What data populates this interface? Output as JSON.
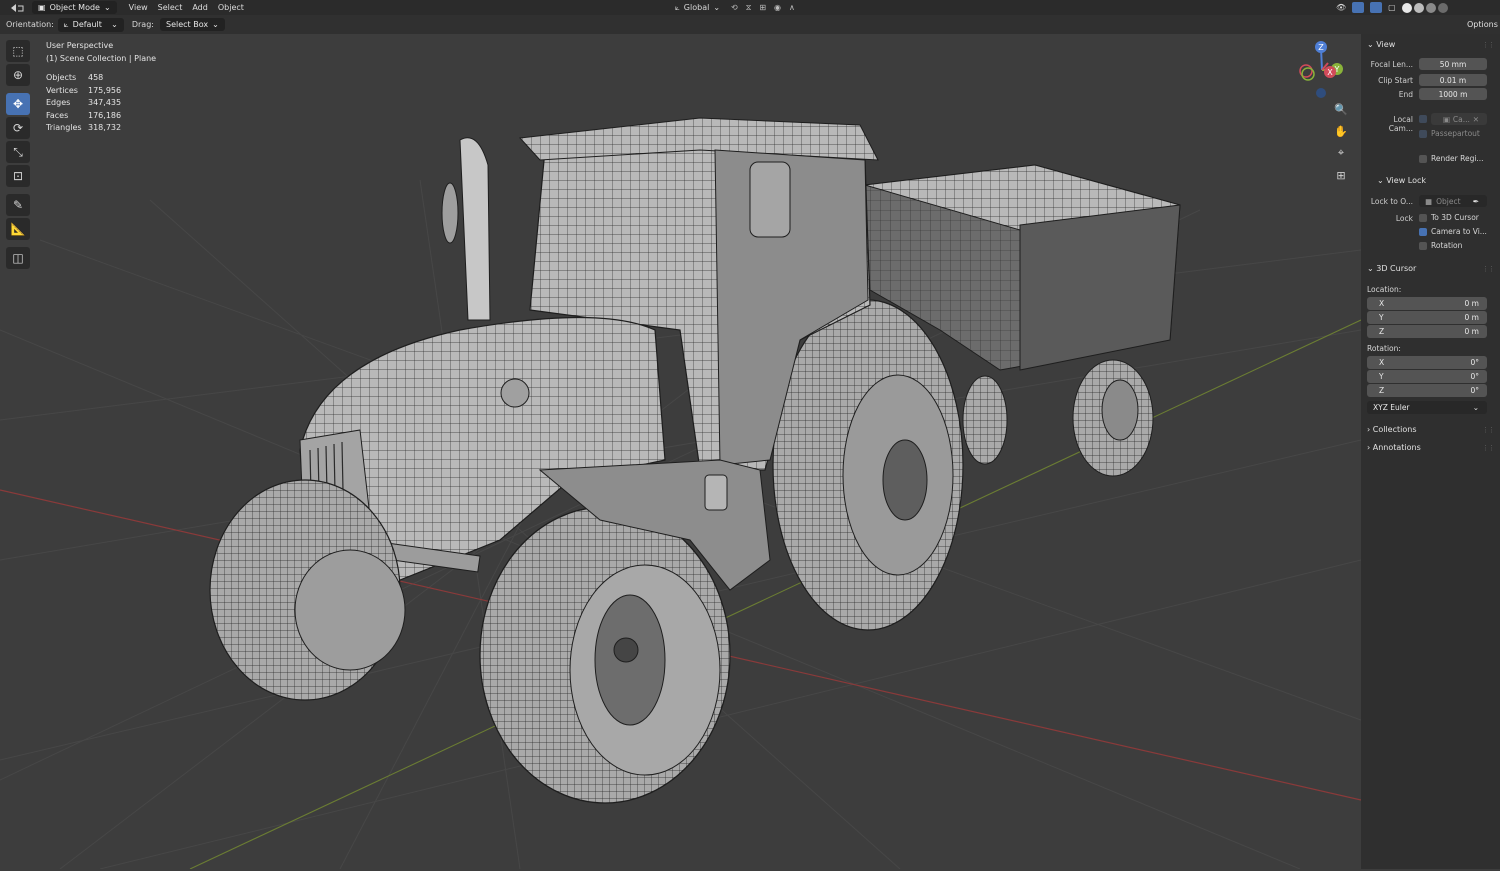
{
  "header": {
    "mode": "Object Mode",
    "menus": [
      "View",
      "Select",
      "Add",
      "Object"
    ],
    "transform_orientation": "Global",
    "options_label": "Options"
  },
  "tool_settings": {
    "orientation_label": "Orientation:",
    "orientation_value": "Default",
    "drag_label": "Drag:",
    "drag_value": "Select Box"
  },
  "overlay": {
    "perspective": "User Perspective",
    "collection": "(1) Scene Collection | Plane",
    "stats": [
      {
        "label": "Objects",
        "value": "458"
      },
      {
        "label": "Vertices",
        "value": "175,956"
      },
      {
        "label": "Edges",
        "value": "347,435"
      },
      {
        "label": "Faces",
        "value": "176,186"
      },
      {
        "label": "Triangles",
        "value": "318,732"
      }
    ]
  },
  "gizmo": {
    "x": "X",
    "y": "Y",
    "z": "Z"
  },
  "npanel": {
    "view_section": "View",
    "focal_length_label": "Focal Len...",
    "focal_length_value": "50 mm",
    "clip_start_label": "Clip Start",
    "clip_start_value": "0.01 m",
    "clip_end_label": "End",
    "clip_end_value": "1000 m",
    "local_camera_label": "Local Cam...",
    "local_camera_value": "Ca...",
    "passepartout_label": "Passepartout",
    "render_region_label": "Render Regi...",
    "view_lock_section": "View Lock",
    "lock_to_object_label": "Lock to O...",
    "lock_to_object_placeholder": "Object",
    "lock_label": "Lock",
    "lock_3d_cursor_label": "To 3D Cursor",
    "lock_camera_label": "Camera to Vi...",
    "lock_rotation_label": "Rotation",
    "cursor_section": "3D Cursor",
    "location_label": "Location:",
    "location": [
      {
        "axis": "X",
        "value": "0 m"
      },
      {
        "axis": "Y",
        "value": "0 m"
      },
      {
        "axis": "Z",
        "value": "0 m"
      }
    ],
    "rotation_label": "Rotation:",
    "rotation": [
      {
        "axis": "X",
        "value": "0°"
      },
      {
        "axis": "Y",
        "value": "0°"
      },
      {
        "axis": "Z",
        "value": "0°"
      }
    ],
    "rotation_mode": "XYZ Euler",
    "collections_section": "Collections",
    "annotations_section": "Annotations"
  }
}
